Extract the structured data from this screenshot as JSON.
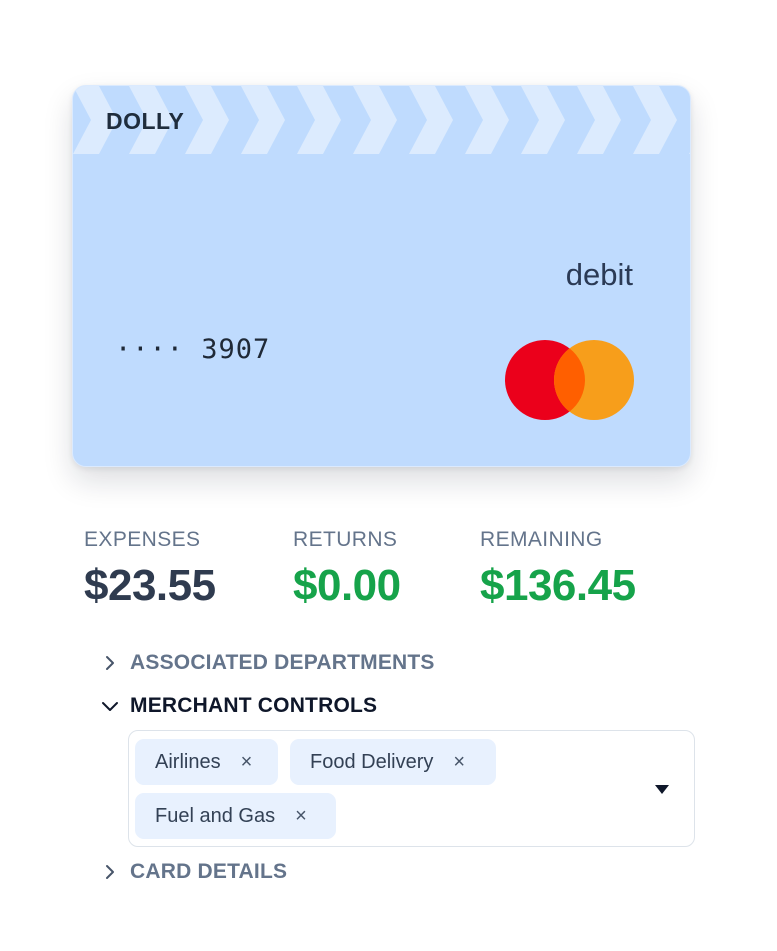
{
  "card": {
    "brand": "DOLLY",
    "type": "debit",
    "number_masked": "···· 3907",
    "network_logo": "mastercard-logo",
    "colors": {
      "background": "#bfdbfe",
      "mc_red": "#eb001b",
      "mc_orange": "#f79e1b",
      "mc_overlap": "#ff5f00"
    }
  },
  "stats": {
    "expenses": {
      "label": "EXPENSES",
      "value": "$23.55"
    },
    "returns": {
      "label": "RETURNS",
      "value": "$0.00"
    },
    "remaining": {
      "label": "REMAINING",
      "value": "$136.45"
    }
  },
  "sections": {
    "associated_departments": {
      "label": "ASSOCIATED DEPARTMENTS",
      "expanded": false
    },
    "merchant_controls": {
      "label": "MERCHANT CONTROLS",
      "expanded": true
    },
    "card_details": {
      "label": "CARD DETAILS",
      "expanded": false
    }
  },
  "merchant_select": {
    "tags": [
      {
        "label": "Airlines",
        "remove": "×"
      },
      {
        "label": "Food Delivery",
        "remove": "×"
      },
      {
        "label": "Fuel and Gas",
        "remove": "×"
      }
    ],
    "icon": "caret-down-icon"
  },
  "colors": {
    "green": "#16a34a",
    "muted": "#64748b",
    "tag_bg": "#e8f1fe"
  }
}
